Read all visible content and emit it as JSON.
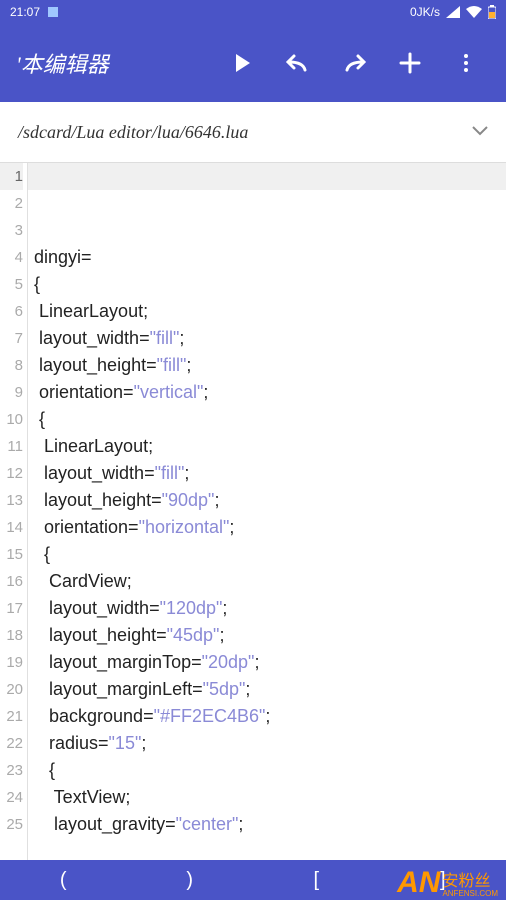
{
  "status": {
    "time": "21:07",
    "net_speed": "0JK/s"
  },
  "app": {
    "title": "'本编辑器"
  },
  "path": {
    "value": "/sdcard/Lua editor/lua/6646.lua"
  },
  "code": {
    "current_line": 1,
    "lines": [
      {
        "n": 1,
        "tokens": []
      },
      {
        "n": 2,
        "tokens": []
      },
      {
        "n": 3,
        "tokens": []
      },
      {
        "n": 4,
        "tokens": [
          {
            "t": "dingyi=",
            "c": ""
          }
        ]
      },
      {
        "n": 5,
        "tokens": [
          {
            "t": "{",
            "c": ""
          }
        ]
      },
      {
        "n": 6,
        "tokens": [
          {
            "t": " LinearLayout;",
            "c": ""
          }
        ]
      },
      {
        "n": 7,
        "tokens": [
          {
            "t": " layout_width=",
            "c": ""
          },
          {
            "t": "\"fill\"",
            "c": "str"
          },
          {
            "t": ";",
            "c": ""
          }
        ]
      },
      {
        "n": 8,
        "tokens": [
          {
            "t": " layout_height=",
            "c": ""
          },
          {
            "t": "\"fill\"",
            "c": "str"
          },
          {
            "t": ";",
            "c": ""
          }
        ]
      },
      {
        "n": 9,
        "tokens": [
          {
            "t": " orientation=",
            "c": ""
          },
          {
            "t": "\"vertical\"",
            "c": "str"
          },
          {
            "t": ";",
            "c": ""
          }
        ]
      },
      {
        "n": 10,
        "tokens": [
          {
            "t": " {",
            "c": ""
          }
        ]
      },
      {
        "n": 11,
        "tokens": [
          {
            "t": "  LinearLayout;",
            "c": ""
          }
        ]
      },
      {
        "n": 12,
        "tokens": [
          {
            "t": "  layout_width=",
            "c": ""
          },
          {
            "t": "\"fill\"",
            "c": "str"
          },
          {
            "t": ";",
            "c": ""
          }
        ]
      },
      {
        "n": 13,
        "tokens": [
          {
            "t": "  layout_height=",
            "c": ""
          },
          {
            "t": "\"90dp\"",
            "c": "str"
          },
          {
            "t": ";",
            "c": ""
          }
        ]
      },
      {
        "n": 14,
        "tokens": [
          {
            "t": "  orientation=",
            "c": ""
          },
          {
            "t": "\"horizontal\"",
            "c": "str"
          },
          {
            "t": ";",
            "c": ""
          }
        ]
      },
      {
        "n": 15,
        "tokens": [
          {
            "t": "  {",
            "c": ""
          }
        ]
      },
      {
        "n": 16,
        "tokens": [
          {
            "t": "   CardView;",
            "c": ""
          }
        ]
      },
      {
        "n": 17,
        "tokens": [
          {
            "t": "   layout_width=",
            "c": ""
          },
          {
            "t": "\"120dp\"",
            "c": "str"
          },
          {
            "t": ";",
            "c": ""
          }
        ]
      },
      {
        "n": 18,
        "tokens": [
          {
            "t": "   layout_height=",
            "c": ""
          },
          {
            "t": "\"45dp\"",
            "c": "str"
          },
          {
            "t": ";",
            "c": ""
          }
        ]
      },
      {
        "n": 19,
        "tokens": [
          {
            "t": "   layout_marginTop=",
            "c": ""
          },
          {
            "t": "\"20dp\"",
            "c": "str"
          },
          {
            "t": ";",
            "c": ""
          }
        ]
      },
      {
        "n": 20,
        "tokens": [
          {
            "t": "   layout_marginLeft=",
            "c": ""
          },
          {
            "t": "\"5dp\"",
            "c": "str"
          },
          {
            "t": ";",
            "c": ""
          }
        ]
      },
      {
        "n": 21,
        "tokens": [
          {
            "t": "   background=",
            "c": ""
          },
          {
            "t": "\"#FF2EC4B6\"",
            "c": "str"
          },
          {
            "t": ";",
            "c": ""
          }
        ]
      },
      {
        "n": 22,
        "tokens": [
          {
            "t": "   radius=",
            "c": ""
          },
          {
            "t": "\"15\"",
            "c": "str"
          },
          {
            "t": ";",
            "c": ""
          }
        ]
      },
      {
        "n": 23,
        "tokens": [
          {
            "t": "   {",
            "c": ""
          }
        ]
      },
      {
        "n": 24,
        "tokens": [
          {
            "t": "    TextView;",
            "c": ""
          }
        ]
      },
      {
        "n": 25,
        "tokens": [
          {
            "t": "    layout_gravity=",
            "c": ""
          },
          {
            "t": "\"center\"",
            "c": "str"
          },
          {
            "t": ";",
            "c": ""
          }
        ]
      }
    ]
  },
  "symbols": [
    "(",
    ")",
    "[",
    "]"
  ],
  "watermark": {
    "logo": "AN",
    "cn": "安粉丝",
    "en": "ANFENSI.COM"
  }
}
